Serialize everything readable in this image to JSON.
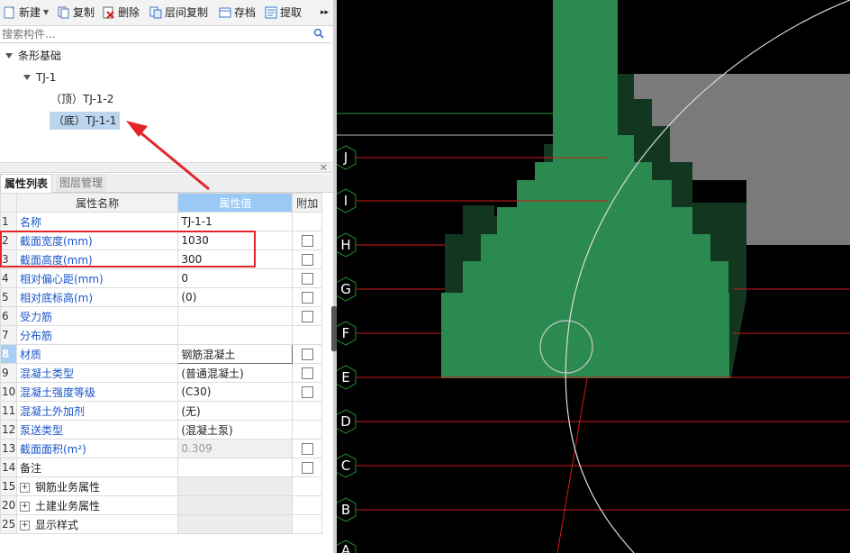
{
  "toolbar": {
    "new_label": "新建",
    "copy_label": "复制",
    "delete_label": "删除",
    "floor_copy_label": "层间复制",
    "save_label": "存档",
    "extract_label": "提取",
    "more_label": "▸▸"
  },
  "search": {
    "placeholder": "搜索构件..."
  },
  "tree": {
    "root": "条形基础",
    "child": "TJ-1",
    "leaf_top": "（顶）TJ-1-2",
    "leaf_bottom": "（底）TJ-1-1"
  },
  "panel_tabs": {
    "properties": "属性列表",
    "layers": "图层管理",
    "close": "×"
  },
  "grid": {
    "headers": {
      "name": "属性名称",
      "value": "属性值",
      "extra": "附加"
    },
    "rows": [
      {
        "no": "1",
        "name": "名称",
        "value": "TJ-1-1"
      },
      {
        "no": "2",
        "name": "截面宽度(mm)",
        "value": "1030"
      },
      {
        "no": "3",
        "name": "截面高度(mm)",
        "value": "300"
      },
      {
        "no": "4",
        "name": "相对偏心距(mm)",
        "value": "0"
      },
      {
        "no": "5",
        "name": "相对底标高(m)",
        "value": "(0)"
      },
      {
        "no": "6",
        "name": "受力筋",
        "value": ""
      },
      {
        "no": "7",
        "name": "分布筋",
        "value": ""
      },
      {
        "no": "8",
        "name": "材质",
        "value": "钢筋混凝土"
      },
      {
        "no": "9",
        "name": "混凝土类型",
        "value": "(普通混凝土)"
      },
      {
        "no": "10",
        "name": "混凝土强度等级",
        "value": "(C30)"
      },
      {
        "no": "11",
        "name": "混凝土外加剂",
        "value": "(无)"
      },
      {
        "no": "12",
        "name": "泵送类型",
        "value": "(混凝土泵)"
      },
      {
        "no": "13",
        "name": "截面面积(m²)",
        "value": "0.309"
      },
      {
        "no": "14",
        "name": "备注",
        "value": ""
      },
      {
        "no": "15",
        "name": "钢筋业务属性",
        "value": ""
      },
      {
        "no": "20",
        "name": "土建业务属性",
        "value": ""
      },
      {
        "no": "25",
        "name": "显示样式",
        "value": ""
      }
    ]
  },
  "axis_labels": [
    "J",
    "I",
    "H",
    "G",
    "F",
    "E",
    "D",
    "C",
    "B",
    "A"
  ],
  "colors": {
    "footing": "#2a8a50",
    "footing_shadow": "#12361f",
    "canvas": "#000000",
    "grid_line": "#d01c1c",
    "axis_marker": "#1e8f2a",
    "highlight_box": "#e3242b"
  }
}
